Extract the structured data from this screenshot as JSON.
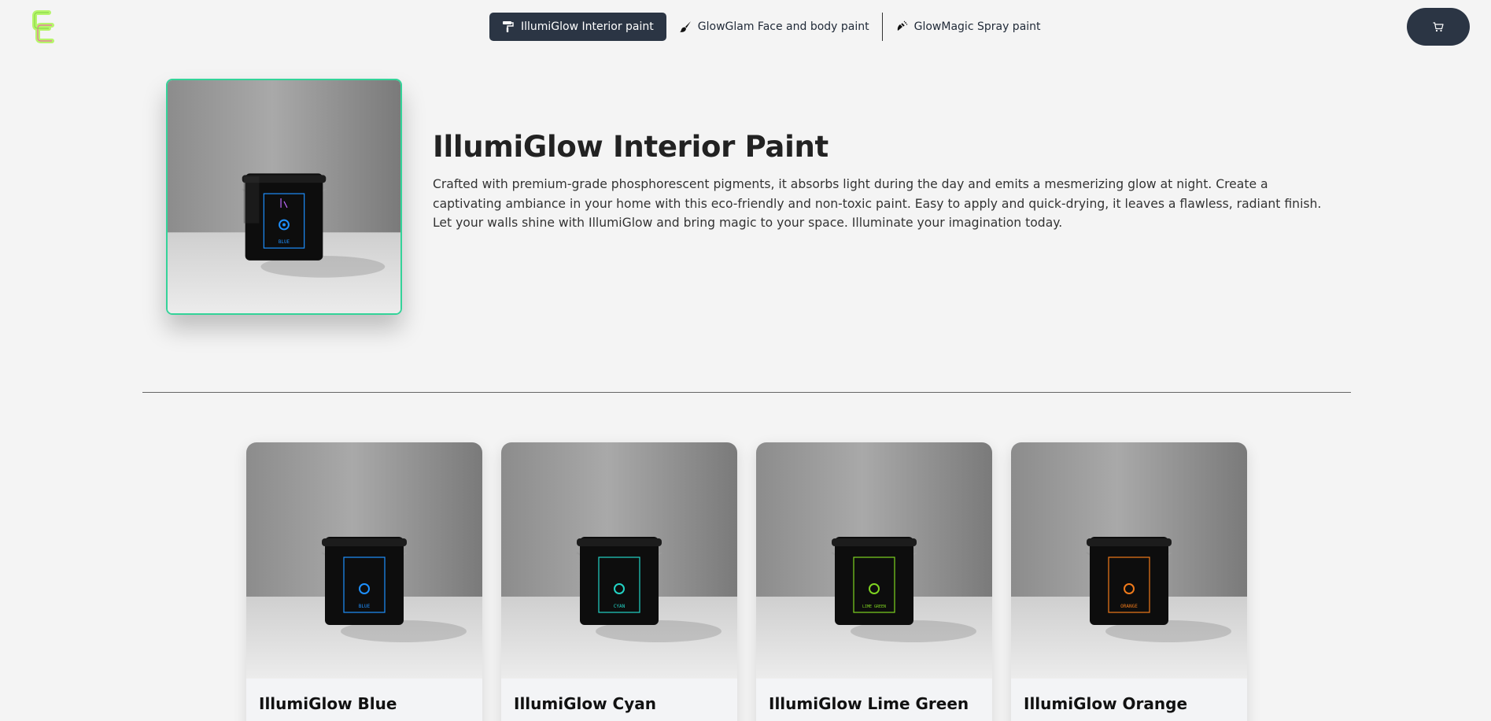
{
  "header": {
    "logo_text": "CC",
    "tabs": [
      {
        "label": "IllumiGlow Interior paint",
        "icon": "paint-roller-icon",
        "active": true
      },
      {
        "label": "GlowGlam Face and body paint",
        "icon": "paint-brush-icon",
        "active": false
      },
      {
        "label": "GlowMagic Spray paint",
        "icon": "spray-can-icon",
        "active": false
      }
    ],
    "cart_icon": "cart-icon"
  },
  "hero": {
    "title": "IllumiGlow Interior Paint",
    "description": "Crafted with premium-grade phosphorescent pigments, it absorbs light during the day and emits a mesmerizing glow at night. Create a captivating ambiance in your home with this eco-friendly and non-toxic paint. Easy to apply and quick-drying, it leaves a flawless, radiant finish. Let your walls shine with IllumiGlow and bring magic to your space. Illuminate your imagination today.",
    "label_text": "BLUE",
    "label_color": "#1e90ff"
  },
  "products": [
    {
      "title": "IllumiGlow Blue",
      "label_text": "BLUE",
      "label_color": "#1e90ff"
    },
    {
      "title": "IllumiGlow Cyan",
      "label_text": "CYAN",
      "label_color": "#22d3c5"
    },
    {
      "title": "IllumiGlow Lime Green",
      "label_text": "LIME GREEN",
      "label_color": "#7ed321"
    },
    {
      "title": "IllumiGlow Orange",
      "label_text": "ORANGE",
      "label_color": "#f07a1a"
    }
  ],
  "colors": {
    "accent_dark": "#2b3544",
    "hero_border": "#34d399",
    "background": "#f4f4f4"
  }
}
